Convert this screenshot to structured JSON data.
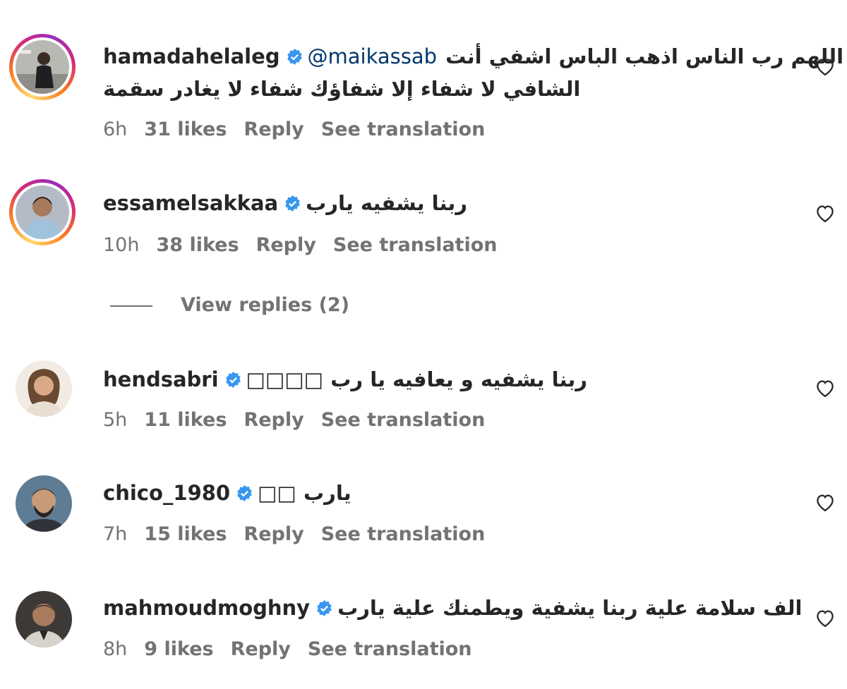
{
  "comments": [
    {
      "username": "hamadahelaleg",
      "mention": "@maikassab",
      "text": "اللهم رب الناس اذهب الباس اشفي أنت",
      "text_line2": "الشافي لا شفاء إلا شفاؤك شفاء لا يغادر سقمة",
      "time": "6h",
      "likes": "31 likes",
      "reply": "Reply",
      "translate": "See translation"
    },
    {
      "username": "essamelsakkaa",
      "text": "ربنا يشفيه يارب",
      "time": "10h",
      "likes": "38 likes",
      "reply": "Reply",
      "translate": "See translation",
      "view_replies": "View replies (2)"
    },
    {
      "username": "hendsabri",
      "text": "ربنا يشفيه و يعافيه يا رب □□□□",
      "time": "5h",
      "likes": "11 likes",
      "reply": "Reply",
      "translate": "See translation"
    },
    {
      "username": "chico_1980",
      "text": "يارب □□",
      "time": "7h",
      "likes": "15 likes",
      "reply": "Reply",
      "translate": "See translation"
    },
    {
      "username": "mahmoudmoghny",
      "text": "الف سلامة علية ربنا يشفية ويطمنك علية يارب",
      "time": "8h",
      "likes": "9 likes",
      "reply": "Reply",
      "translate": "See translation"
    }
  ],
  "icons": {
    "verified": "verified-badge-icon",
    "like": "heart-icon"
  },
  "colors": {
    "verified": "#3897f0",
    "mention": "#00376b",
    "meta": "#737373",
    "text": "#262626"
  }
}
